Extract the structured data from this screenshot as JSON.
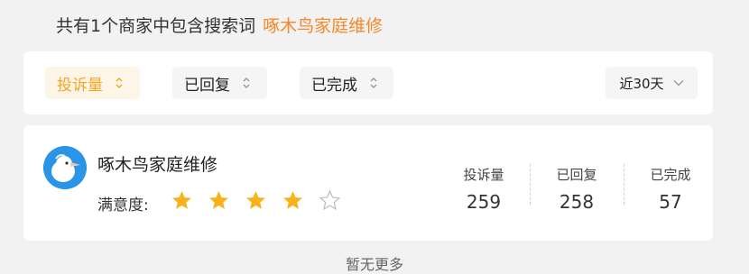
{
  "summary": {
    "text": "共有1个商家中包含搜索词",
    "keyword": "啄木鸟家庭维修"
  },
  "filters": {
    "sort_complaints": "投诉量",
    "sort_replied": "已回复",
    "sort_completed": "已完成",
    "time_range": "近30天",
    "active_color": "#f5a623"
  },
  "merchant": {
    "name": "啄木鸟家庭维修",
    "rating_label": "满意度:",
    "rating": 4,
    "rating_max": 5,
    "stats": [
      {
        "label": "投诉量",
        "value": "259"
      },
      {
        "label": "已回复",
        "value": "258"
      },
      {
        "label": "已完成",
        "value": "57"
      }
    ]
  },
  "footer": {
    "no_more": "暂无更多"
  },
  "colors": {
    "keyword": "#f5882a",
    "star": "#f9b21b",
    "avatar_bg": "#2a95e6"
  }
}
